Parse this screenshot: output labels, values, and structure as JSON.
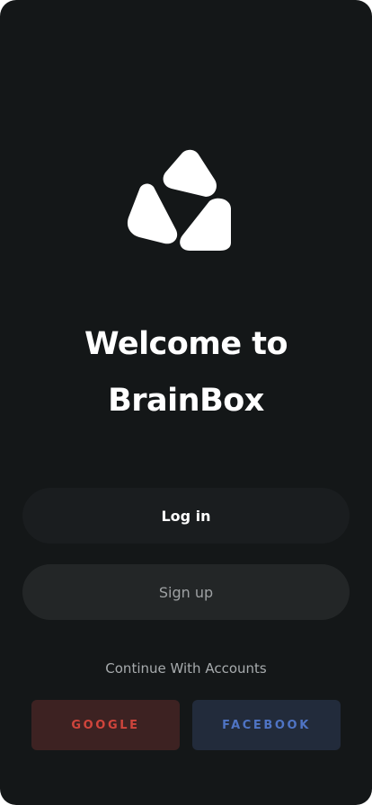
{
  "app": {
    "brand_icon": "brainbox-logo-icon"
  },
  "welcome": {
    "line1": "Welcome to",
    "line2": "BrainBox"
  },
  "actions": {
    "login_label": "Log in",
    "signup_label": "Sign up"
  },
  "social": {
    "prompt": "Continue With Accounts",
    "google_label": "GOOGLE",
    "facebook_label": "FACEBOOK",
    "google_color": "#d0453c",
    "facebook_color": "#4f74c4"
  },
  "colors": {
    "background": "#141718",
    "login_button": "#1a1d1f",
    "signup_button": "#232627"
  }
}
